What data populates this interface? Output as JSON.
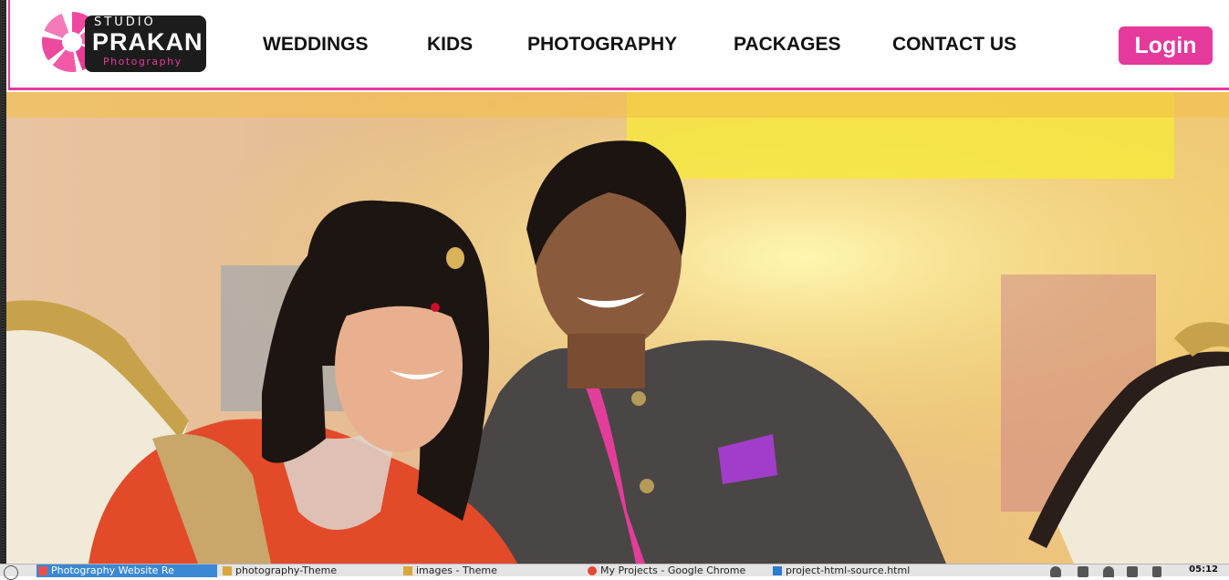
{
  "brand": {
    "studio": "STUDIO",
    "name": "PRAKAN",
    "tagline": "Photography"
  },
  "nav": {
    "items": [
      {
        "label": "WEDDINGS"
      },
      {
        "label": "KIDS"
      },
      {
        "label": "PHOTOGRAPHY"
      },
      {
        "label": "PACKAGES"
      },
      {
        "label": "CONTACT US"
      }
    ],
    "login_label": "Login"
  },
  "hero": {
    "image": "couple-portrait"
  },
  "colors": {
    "accent": "#e5399b",
    "header_bg": "#ffffff",
    "nav_text": "#111111"
  },
  "taskbar": {
    "tasks": [
      {
        "label": "Photography Website Re",
        "icon": "app-icon",
        "active": true
      },
      {
        "label": "photography-Theme",
        "icon": "folder-icon",
        "active": false
      },
      {
        "label": "images - Theme",
        "icon": "folder-icon",
        "active": false
      },
      {
        "label": "My Projects - Google Chrome",
        "icon": "chrome-icon",
        "active": false
      },
      {
        "label": "project-html-source.html",
        "icon": "code-editor-icon",
        "active": false
      }
    ],
    "clock": "05:12"
  }
}
